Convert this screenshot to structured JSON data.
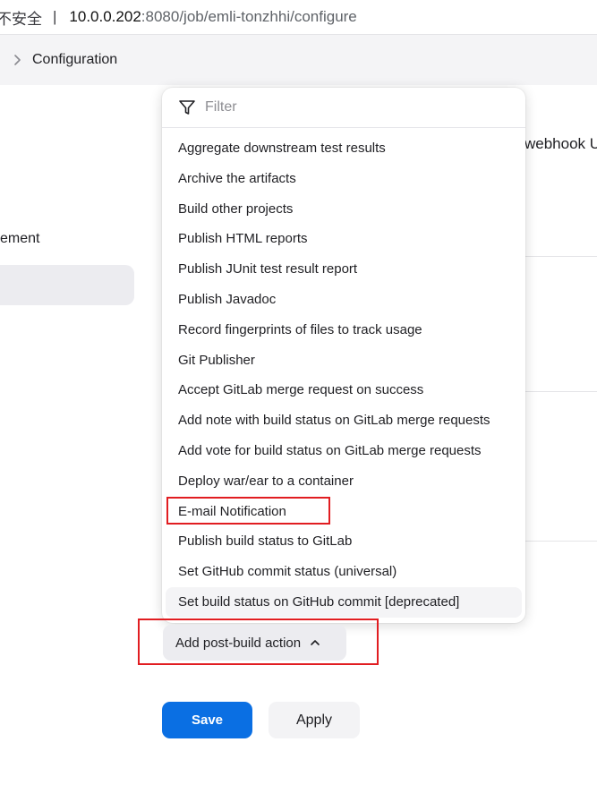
{
  "address_bar": {
    "insecure_label": "不安全",
    "host": "10.0.0.202",
    "path": ":8080/job/emli-tonzhhi/configure"
  },
  "breadcrumb": {
    "current": "Configuration"
  },
  "sidebar": {
    "partial_item": "ement"
  },
  "background": {
    "webhook_text": "webhook U"
  },
  "dropdown": {
    "filter_placeholder": "Filter",
    "items": [
      "Aggregate downstream test results",
      "Archive the artifacts",
      "Build other projects",
      "Publish HTML reports",
      "Publish JUnit test result report",
      "Publish Javadoc",
      "Record fingerprints of files to track usage",
      "Git Publisher",
      "Accept GitLab merge request on success",
      "Add note with build status on GitLab merge requests",
      "Add vote for build status on GitLab merge requests",
      "Deploy war/ear to a container",
      "E-mail Notification",
      "Publish build status to GitLab",
      "Set GitHub commit status (universal)",
      "Set build status on GitHub commit [deprecated]"
    ]
  },
  "actions": {
    "add_post_build": "Add post-build action",
    "save": "Save",
    "apply": "Apply"
  },
  "colors": {
    "primary": "#0a6fe3",
    "highlight": "#e11d21"
  },
  "icons": {
    "filter": "filter-icon",
    "breadcrumb_chevron": "chevron-right-icon",
    "add_caret": "chevron-up-icon"
  }
}
